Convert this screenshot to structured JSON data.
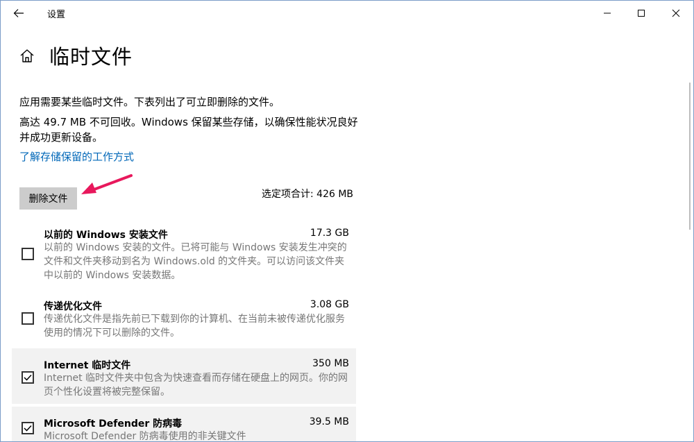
{
  "window": {
    "title": "设置"
  },
  "page": {
    "title": "临时文件"
  },
  "intro": {
    "line1": "应用需要某些临时文件。下表列出了可立即删除的文件。",
    "line2": "高达 49.7 MB 不可回收。Windows 保留某些存储，以确保性能状况良好并成功更新设备。",
    "link": "了解存储保留的工作方式"
  },
  "actions": {
    "delete_label": "删除文件",
    "total": "选定项合计: 426 MB"
  },
  "items": [
    {
      "title": "以前的 Windows 安装文件",
      "size": "17.3 GB",
      "desc": "以前的 Windows 安装的文件。已将可能与 Windows 安装发生冲突的文件和文件夹移动到名为 Windows.old 的文件夹。可以访问该文件夹中以前的 Windows 安装数据。",
      "checked": false
    },
    {
      "title": "传递优化文件",
      "size": "3.08 GB",
      "desc": "传递优化文件是指先前已下载到你的计算机、在当前未被传递优化服务使用的情况下可以删除的文件。",
      "checked": false
    },
    {
      "title": "Internet 临时文件",
      "size": "350 MB",
      "desc": "Internet 临时文件夹中包含为快速查看而存储在硬盘上的网页。你的网页个性化设置将被完整保留。",
      "checked": true
    },
    {
      "title": "Microsoft Defender 防病毒",
      "size": "39.5 MB",
      "desc": "Microsoft Defender 防病毒使用的非关键文件",
      "checked": true
    }
  ],
  "colors": {
    "link": "#0067b8",
    "annotation_arrow": "#e8185c",
    "checked_row_bg": "#f2f2f2"
  }
}
